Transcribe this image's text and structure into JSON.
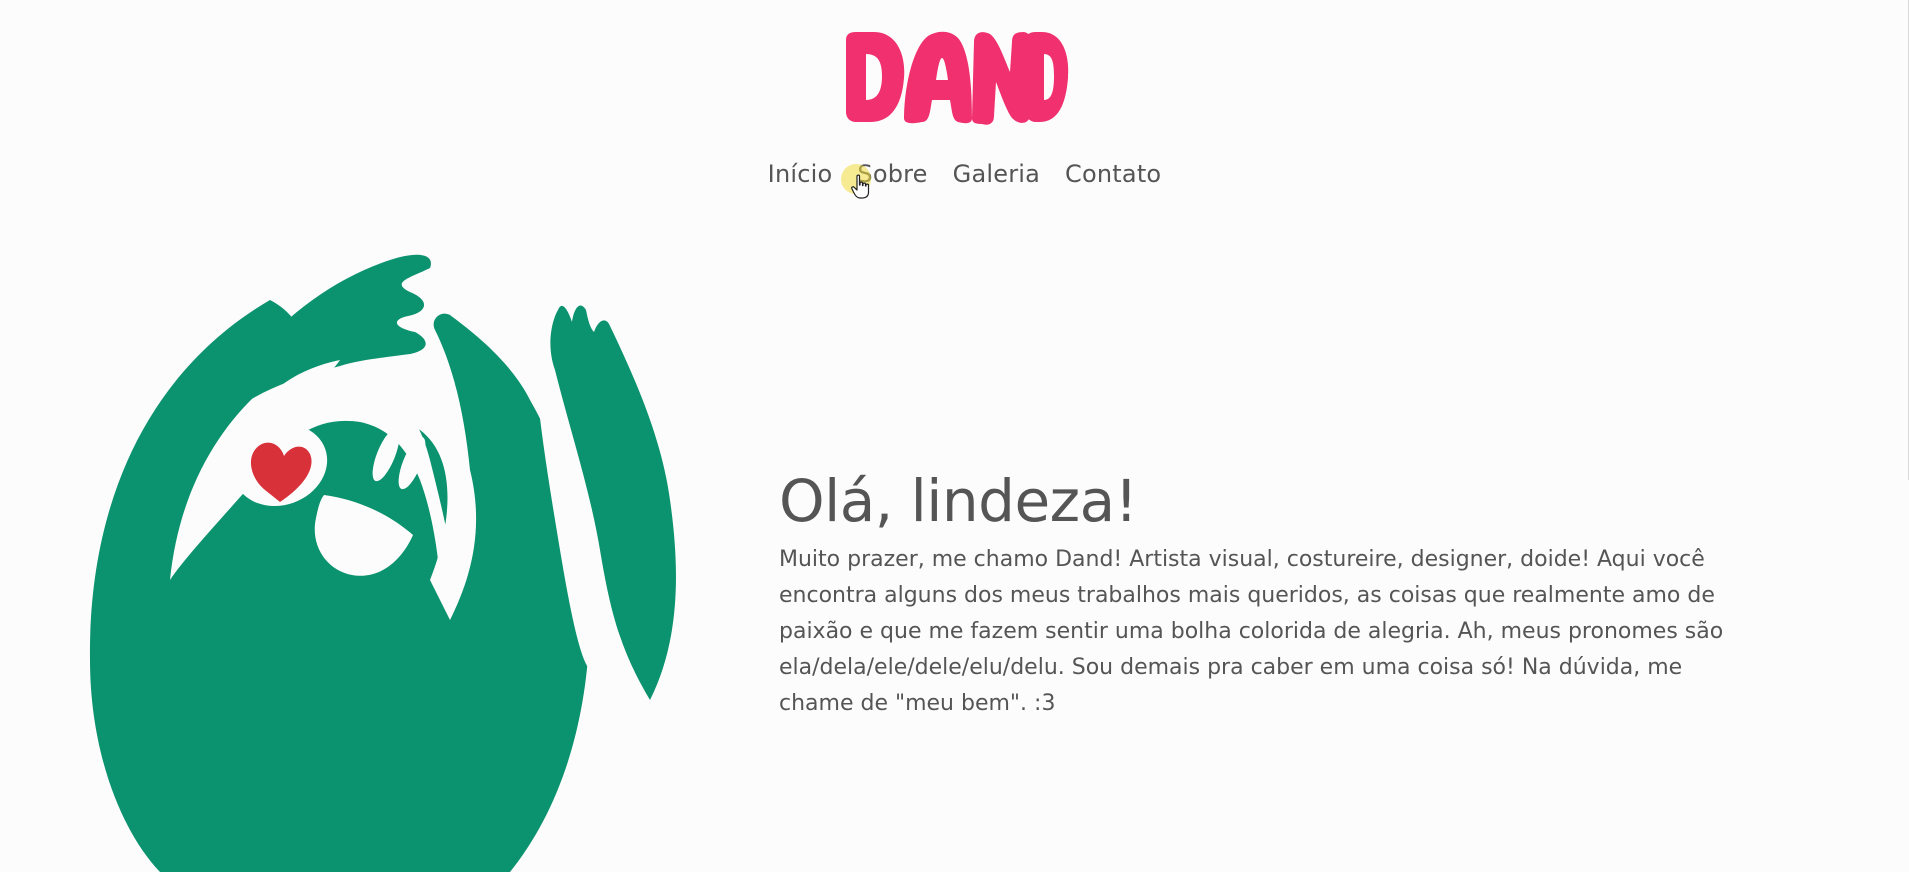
{
  "header": {
    "logo_text": "DAND",
    "brand_color": "#f0306f"
  },
  "nav": {
    "items": [
      {
        "label": "Início"
      },
      {
        "label": "Sobre"
      },
      {
        "label": "Galeria"
      },
      {
        "label": "Contato"
      }
    ],
    "hovered": "Sobre"
  },
  "hero": {
    "title": "Olá, lindeza!",
    "body": "Muito prazer, me chamo Dand! Artista visual, costureire, designer, doide! Aqui você encontra alguns dos meus trabalhos mais queridos, as coisas que realmente amo de paixão e que me fazem sentir uma bolha colorida de alegria. Ah, meus pronomes são ela/dela/ele/dele/elu/delu. Sou demais pra caber em uma coisa só! Na dúvida, me chame de \"meu bem\". :3"
  },
  "mascot": {
    "icon": "green-blob-mascot-with-heart",
    "body_color": "#0a936e",
    "heart_color": "#d8313a"
  },
  "colors": {
    "text": "#555555",
    "background": "#fdfcfc",
    "cursor_halo": "#f0dc3c"
  }
}
